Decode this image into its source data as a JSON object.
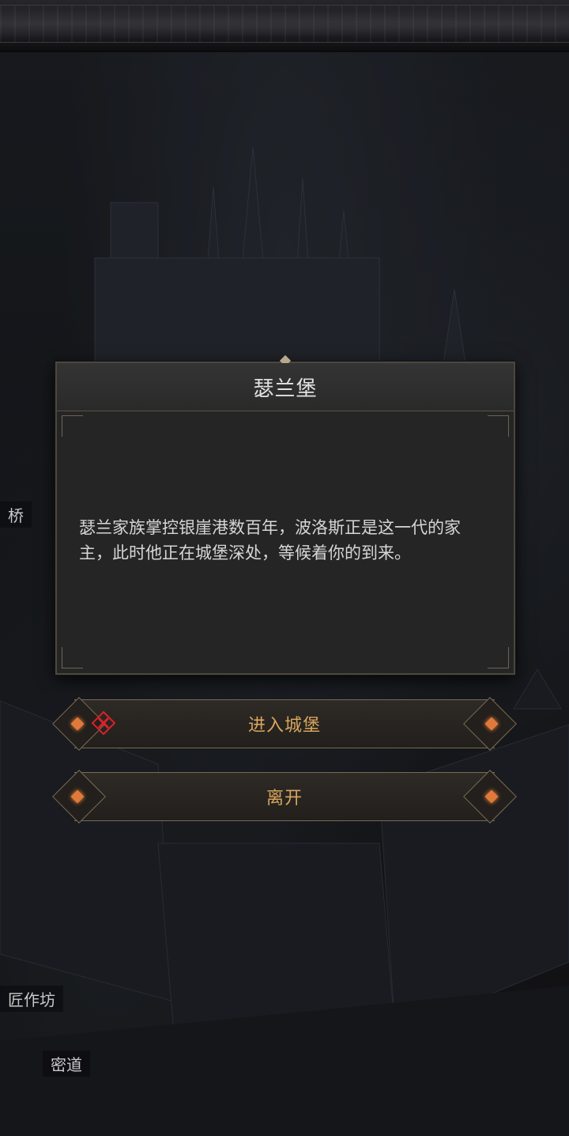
{
  "dialog": {
    "title": "瑟兰堡",
    "description": "瑟兰家族掌控银崖港数百年，波洛斯正是这一代的家主，此时他正在城堡深处，等候着你的到来。"
  },
  "actions": {
    "enter_label": "进入城堡",
    "leave_label": "离开"
  },
  "map_labels": {
    "bridge": "桥",
    "workshop": "匠作坊",
    "secret_passage": "密道"
  },
  "colors": {
    "button_text": "#d9a65c",
    "accent_gem": "#e07a3a",
    "close_icon": "#d9222a"
  },
  "icons": [
    "close-x-icon",
    "diamond-ornament-icon"
  ]
}
